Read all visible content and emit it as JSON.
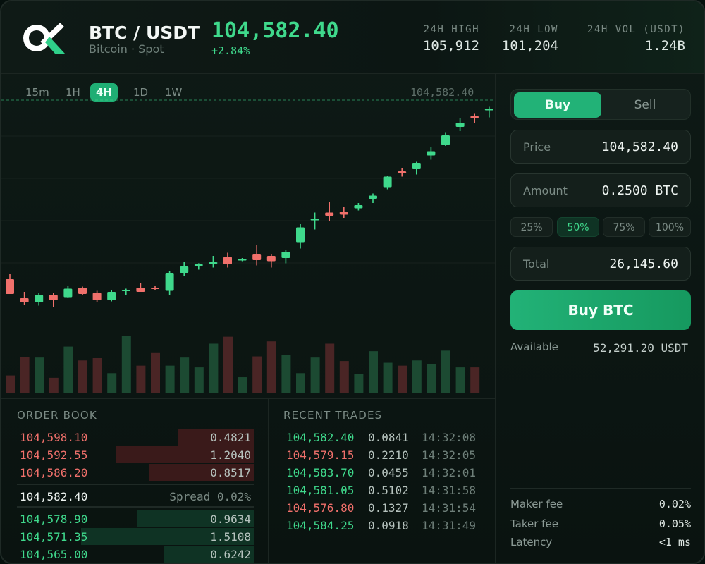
{
  "header": {
    "pair": "BTC / USDT",
    "subtitle": "Bitcoin · Spot",
    "last_price": "104,582.40",
    "change": "+2.84%",
    "stats": [
      {
        "label": "24H HIGH",
        "value": "105,912"
      },
      {
        "label": "24H LOW",
        "value": "101,204"
      },
      {
        "label": "24H VOL (USDT)",
        "value": "1.24B"
      }
    ]
  },
  "chart": {
    "timeframes": [
      "15m",
      "1H",
      "4H",
      "1D",
      "1W"
    ],
    "active_timeframe": "4H",
    "current_price_label": "104,582.40",
    "colors": {
      "up": "#3fd98c",
      "down": "#f0706b"
    }
  },
  "chart_data": {
    "type": "candlestick",
    "candles": [
      {
        "o": 0.26,
        "h": 0.31,
        "l": 0.14,
        "c": 0.12
      },
      {
        "o": 0.08,
        "h": 0.14,
        "l": 0.02,
        "c": 0.04
      },
      {
        "o": 0.04,
        "h": 0.13,
        "l": 0.01,
        "c": 0.11
      },
      {
        "o": 0.11,
        "h": 0.13,
        "l": 0.0,
        "c": 0.06
      },
      {
        "o": 0.09,
        "h": 0.2,
        "l": 0.08,
        "c": 0.17
      },
      {
        "o": 0.18,
        "h": 0.19,
        "l": 0.11,
        "c": 0.12
      },
      {
        "o": 0.13,
        "h": 0.15,
        "l": 0.04,
        "c": 0.06
      },
      {
        "o": 0.06,
        "h": 0.16,
        "l": 0.05,
        "c": 0.14
      },
      {
        "o": 0.15,
        "h": 0.17,
        "l": 0.11,
        "c": 0.16
      },
      {
        "o": 0.18,
        "h": 0.22,
        "l": 0.14,
        "c": 0.14
      },
      {
        "o": 0.18,
        "h": 0.2,
        "l": 0.16,
        "c": 0.17
      },
      {
        "o": 0.15,
        "h": 0.34,
        "l": 0.11,
        "c": 0.32
      },
      {
        "o": 0.32,
        "h": 0.42,
        "l": 0.29,
        "c": 0.38
      },
      {
        "o": 0.4,
        "h": 0.41,
        "l": 0.35,
        "c": 0.4
      },
      {
        "o": 0.41,
        "h": 0.48,
        "l": 0.37,
        "c": 0.42
      },
      {
        "o": 0.47,
        "h": 0.51,
        "l": 0.37,
        "c": 0.4
      },
      {
        "o": 0.45,
        "h": 0.46,
        "l": 0.43,
        "c": 0.45
      },
      {
        "o": 0.5,
        "h": 0.58,
        "l": 0.39,
        "c": 0.44
      },
      {
        "o": 0.48,
        "h": 0.5,
        "l": 0.37,
        "c": 0.43
      },
      {
        "o": 0.46,
        "h": 0.54,
        "l": 0.41,
        "c": 0.52
      },
      {
        "o": 0.61,
        "h": 0.78,
        "l": 0.55,
        "c": 0.75
      },
      {
        "o": 0.83,
        "h": 0.89,
        "l": 0.73,
        "c": 0.83
      },
      {
        "o": 0.89,
        "h": 0.99,
        "l": 0.81,
        "c": 0.86
      },
      {
        "o": 0.9,
        "h": 0.94,
        "l": 0.84,
        "c": 0.87
      },
      {
        "o": 0.93,
        "h": 0.98,
        "l": 0.91,
        "c": 0.96
      },
      {
        "o": 1.02,
        "h": 1.07,
        "l": 0.98,
        "c": 1.05
      },
      {
        "o": 1.13,
        "h": 1.24,
        "l": 1.11,
        "c": 1.23
      },
      {
        "o": 1.28,
        "h": 1.31,
        "l": 1.23,
        "c": 1.26
      },
      {
        "o": 1.3,
        "h": 1.37,
        "l": 1.25,
        "c": 1.36
      },
      {
        "o": 1.43,
        "h": 1.51,
        "l": 1.39,
        "c": 1.47
      },
      {
        "o": 1.53,
        "h": 1.65,
        "l": 1.52,
        "c": 1.62
      },
      {
        "o": 1.7,
        "h": 1.78,
        "l": 1.66,
        "c": 1.74
      },
      {
        "o": 1.8,
        "h": 1.83,
        "l": 1.74,
        "c": 1.79
      },
      {
        "o": 1.86,
        "h": 1.89,
        "l": 1.79,
        "c": 1.87
      }
    ],
    "volume": [
      0.31,
      0.63,
      0.62,
      0.27,
      0.81,
      0.57,
      0.61,
      0.35,
      1.0,
      0.48,
      0.71,
      0.48,
      0.62,
      0.45,
      0.86,
      0.98,
      0.28,
      0.64,
      0.9,
      0.67,
      0.35,
      0.62,
      0.86,
      0.56,
      0.33,
      0.73,
      0.53,
      0.48,
      0.57,
      0.51,
      0.74,
      0.45,
      0.45
    ]
  },
  "order_book": {
    "title": "ORDER BOOK",
    "asks": [
      {
        "price": "104,598.10",
        "qty": "0.4821",
        "depth": 0.32
      },
      {
        "price": "104,592.55",
        "qty": "1.2040",
        "depth": 0.58
      },
      {
        "price": "104,586.20",
        "qty": "0.8517",
        "depth": 0.44
      }
    ],
    "mid_price": "104,582.40",
    "spread": "Spread 0.02%",
    "bids": [
      {
        "price": "104,578.90",
        "qty": "0.9634",
        "depth": 0.49
      },
      {
        "price": "104,571.35",
        "qty": "1.5108",
        "depth": 0.73
      },
      {
        "price": "104,565.00",
        "qty": "0.6242",
        "depth": 0.38
      }
    ]
  },
  "recent_trades": {
    "title": "RECENT TRADES",
    "rows": [
      {
        "price": "104,582.40",
        "amount": "0.0841",
        "time": "14:32:08",
        "side": "buy"
      },
      {
        "price": "104,579.15",
        "amount": "0.2210",
        "time": "14:32:05",
        "side": "sell"
      },
      {
        "price": "104,583.70",
        "amount": "0.0455",
        "time": "14:32:01",
        "side": "buy"
      },
      {
        "price": "104,581.05",
        "amount": "0.5102",
        "time": "14:31:58",
        "side": "buy"
      },
      {
        "price": "104,576.80",
        "amount": "0.1327",
        "time": "14:31:54",
        "side": "sell"
      },
      {
        "price": "104,584.25",
        "amount": "0.0918",
        "time": "14:31:49",
        "side": "buy"
      }
    ]
  },
  "order_form": {
    "buy_tab": "Buy",
    "sell_tab": "Sell",
    "price_label": "Price",
    "price_value": "104,582.40",
    "amount_label": "Amount",
    "amount_value": "0.2500 BTC",
    "percentages": [
      "25%",
      "50%",
      "75%",
      "100%"
    ],
    "active_percentage": "50%",
    "total_label": "Total",
    "total_value": "26,145.60",
    "submit_label": "Buy BTC",
    "available_label": "Available",
    "available_value": "52,291.20 USDT"
  },
  "fees": [
    {
      "label": "Maker fee",
      "value": "0.02%"
    },
    {
      "label": "Taker fee",
      "value": "0.05%"
    },
    {
      "label": "Latency",
      "value": "<1 ms"
    }
  ]
}
